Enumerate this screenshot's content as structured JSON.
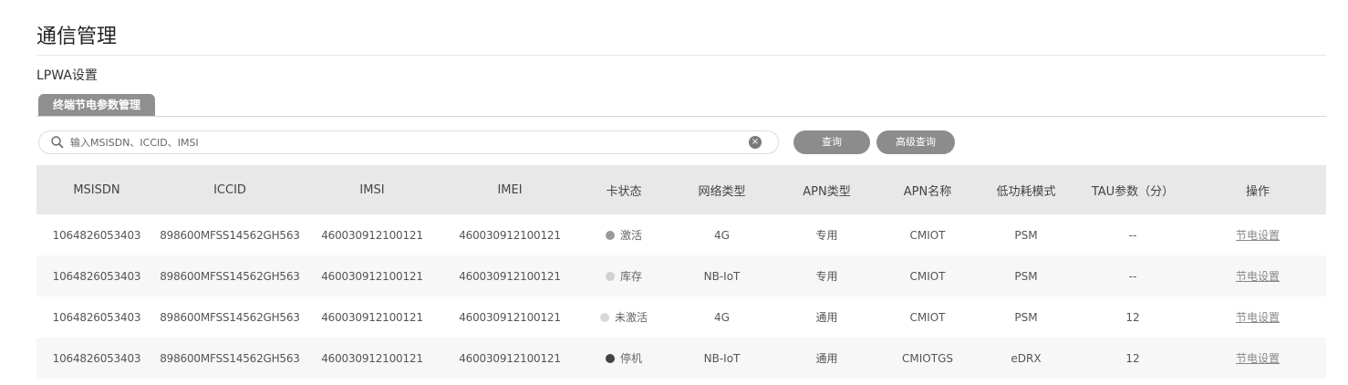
{
  "page": {
    "title": "通信管理",
    "section_title": "LPWA设置"
  },
  "tabs": [
    {
      "label": "终端节电参数管理",
      "active": true
    }
  ],
  "search": {
    "placeholder": "输入MSISDN、ICCID、IMSI",
    "value": "",
    "icon": "search-icon",
    "clear_icon": "clear-icon"
  },
  "buttons": {
    "query": "查询",
    "advanced_query": "高级查询"
  },
  "table": {
    "columns": [
      "MSISDN",
      "ICCID",
      "IMSI",
      "IMEI",
      "卡状态",
      "网络类型",
      "APN类型",
      "APN名称",
      "低功耗模式",
      "TAU参数（分）",
      "操作"
    ],
    "rows": [
      {
        "msisdn": "1064826053403",
        "iccid": "898600MFSS14562GH563",
        "imsi": "460030912100121",
        "imei": "460030912100121",
        "status": "激活",
        "status_color": "#9a9a9a",
        "network": "4G",
        "apn_type": "专用",
        "apn_name": "CMIOT",
        "power_mode": "PSM",
        "tau": "--",
        "action": "节电设置"
      },
      {
        "msisdn": "1064826053403",
        "iccid": "898600MFSS14562GH563",
        "imsi": "460030912100121",
        "imei": "460030912100121",
        "status": "库存",
        "status_color": "#d0d0d0",
        "network": "NB-IoT",
        "apn_type": "专用",
        "apn_name": "CMIOT",
        "power_mode": "PSM",
        "tau": "--",
        "action": "节电设置"
      },
      {
        "msisdn": "1064826053403",
        "iccid": "898600MFSS14562GH563",
        "imsi": "460030912100121",
        "imei": "460030912100121",
        "status": "未激活",
        "status_color": "#d8d8d8",
        "network": "4G",
        "apn_type": "通用",
        "apn_name": "CMIOT",
        "power_mode": "PSM",
        "tau": "12",
        "action": "节电设置"
      },
      {
        "msisdn": "1064826053403",
        "iccid": "898600MFSS14562GH563",
        "imsi": "460030912100121",
        "imei": "460030912100121",
        "status": "停机",
        "status_color": "#444444",
        "network": "NB-IoT",
        "apn_type": "通用",
        "apn_name": "CMIOTGS",
        "power_mode": "eDRX",
        "tau": "12",
        "action": "节电设置"
      }
    ]
  }
}
